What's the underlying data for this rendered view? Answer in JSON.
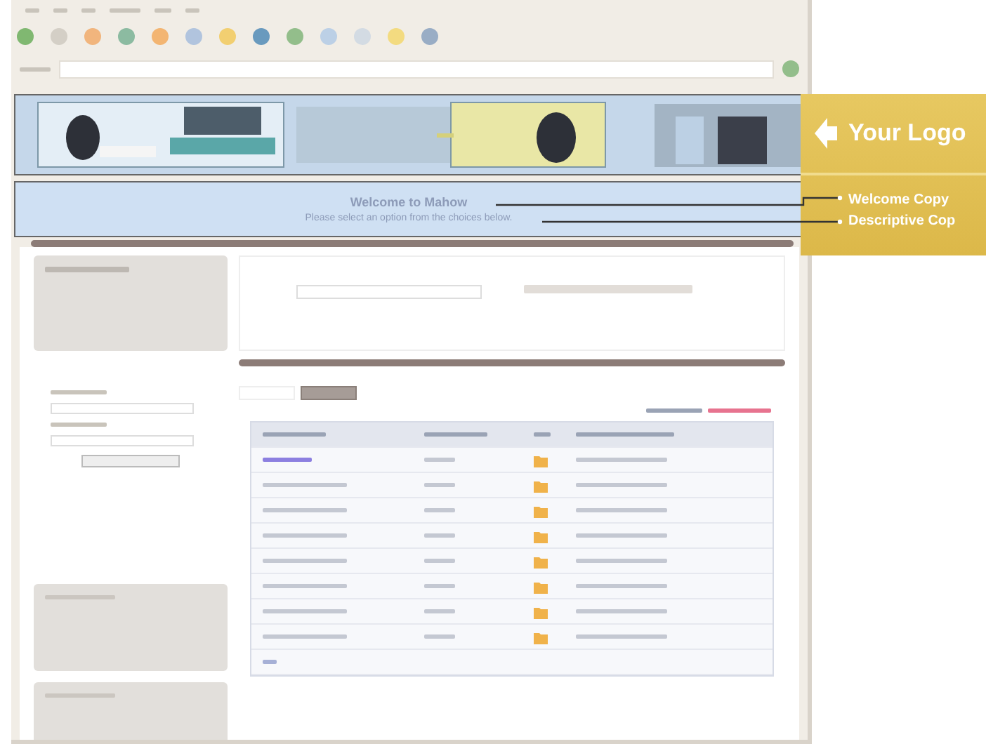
{
  "welcome": {
    "title": "Welcome to Mahow",
    "subtitle": "Please select an option from the choices below."
  },
  "callouts": {
    "logo": "Your Logo",
    "labels": [
      "Welcome Copy",
      "Descriptive Cop"
    ]
  },
  "tabs": [
    {
      "selected": false
    },
    {
      "selected": true
    }
  ],
  "table": {
    "rows": [
      {
        "linked": true
      },
      {
        "linked": false
      },
      {
        "linked": false
      },
      {
        "linked": false
      },
      {
        "linked": false
      },
      {
        "linked": false
      },
      {
        "linked": false
      },
      {
        "linked": false
      }
    ]
  }
}
